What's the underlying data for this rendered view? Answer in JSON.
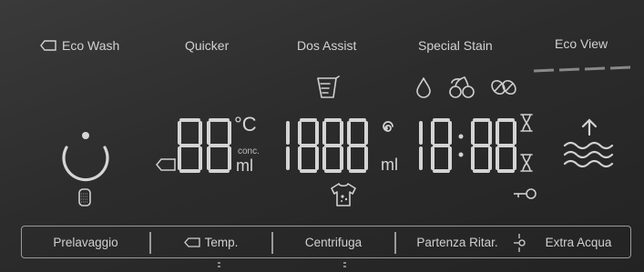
{
  "functions": {
    "eco_wash": "Eco Wash",
    "quicker": "Quicker",
    "dos_assist": "Dos Assist",
    "special_stain": "Special Stain",
    "eco_view": "Eco View"
  },
  "display": {
    "temp_digits": "88",
    "temp_unit": "°C",
    "conc_label": "conc.",
    "ml_label": "ml",
    "dose_digits": "1888",
    "dose_unit": "ml",
    "clock_left": "18",
    "clock_right": "88",
    "clock_colon": ":"
  },
  "buttons": {
    "prewash": "Prelavaggio",
    "temp": "Temp.",
    "spin": "Centrifuga",
    "delay_start": "Partenza Ritar.",
    "extra_water": "Extra Acqua"
  },
  "icons": {
    "eco_wash_icon": "tag-icon",
    "detergent_cup": "measuring-cup-icon",
    "stain_icons": [
      "drop-icon",
      "cherries-icon",
      "coffee-beans-icon"
    ],
    "power": "power-icon",
    "drum_filter": "filter-icon",
    "spiral": "spiral-icon",
    "tshirt": "stained-shirt-icon",
    "hourglass": "hourglass-icon",
    "key_lock": "key-icon",
    "water_level": "water-level-icon"
  }
}
